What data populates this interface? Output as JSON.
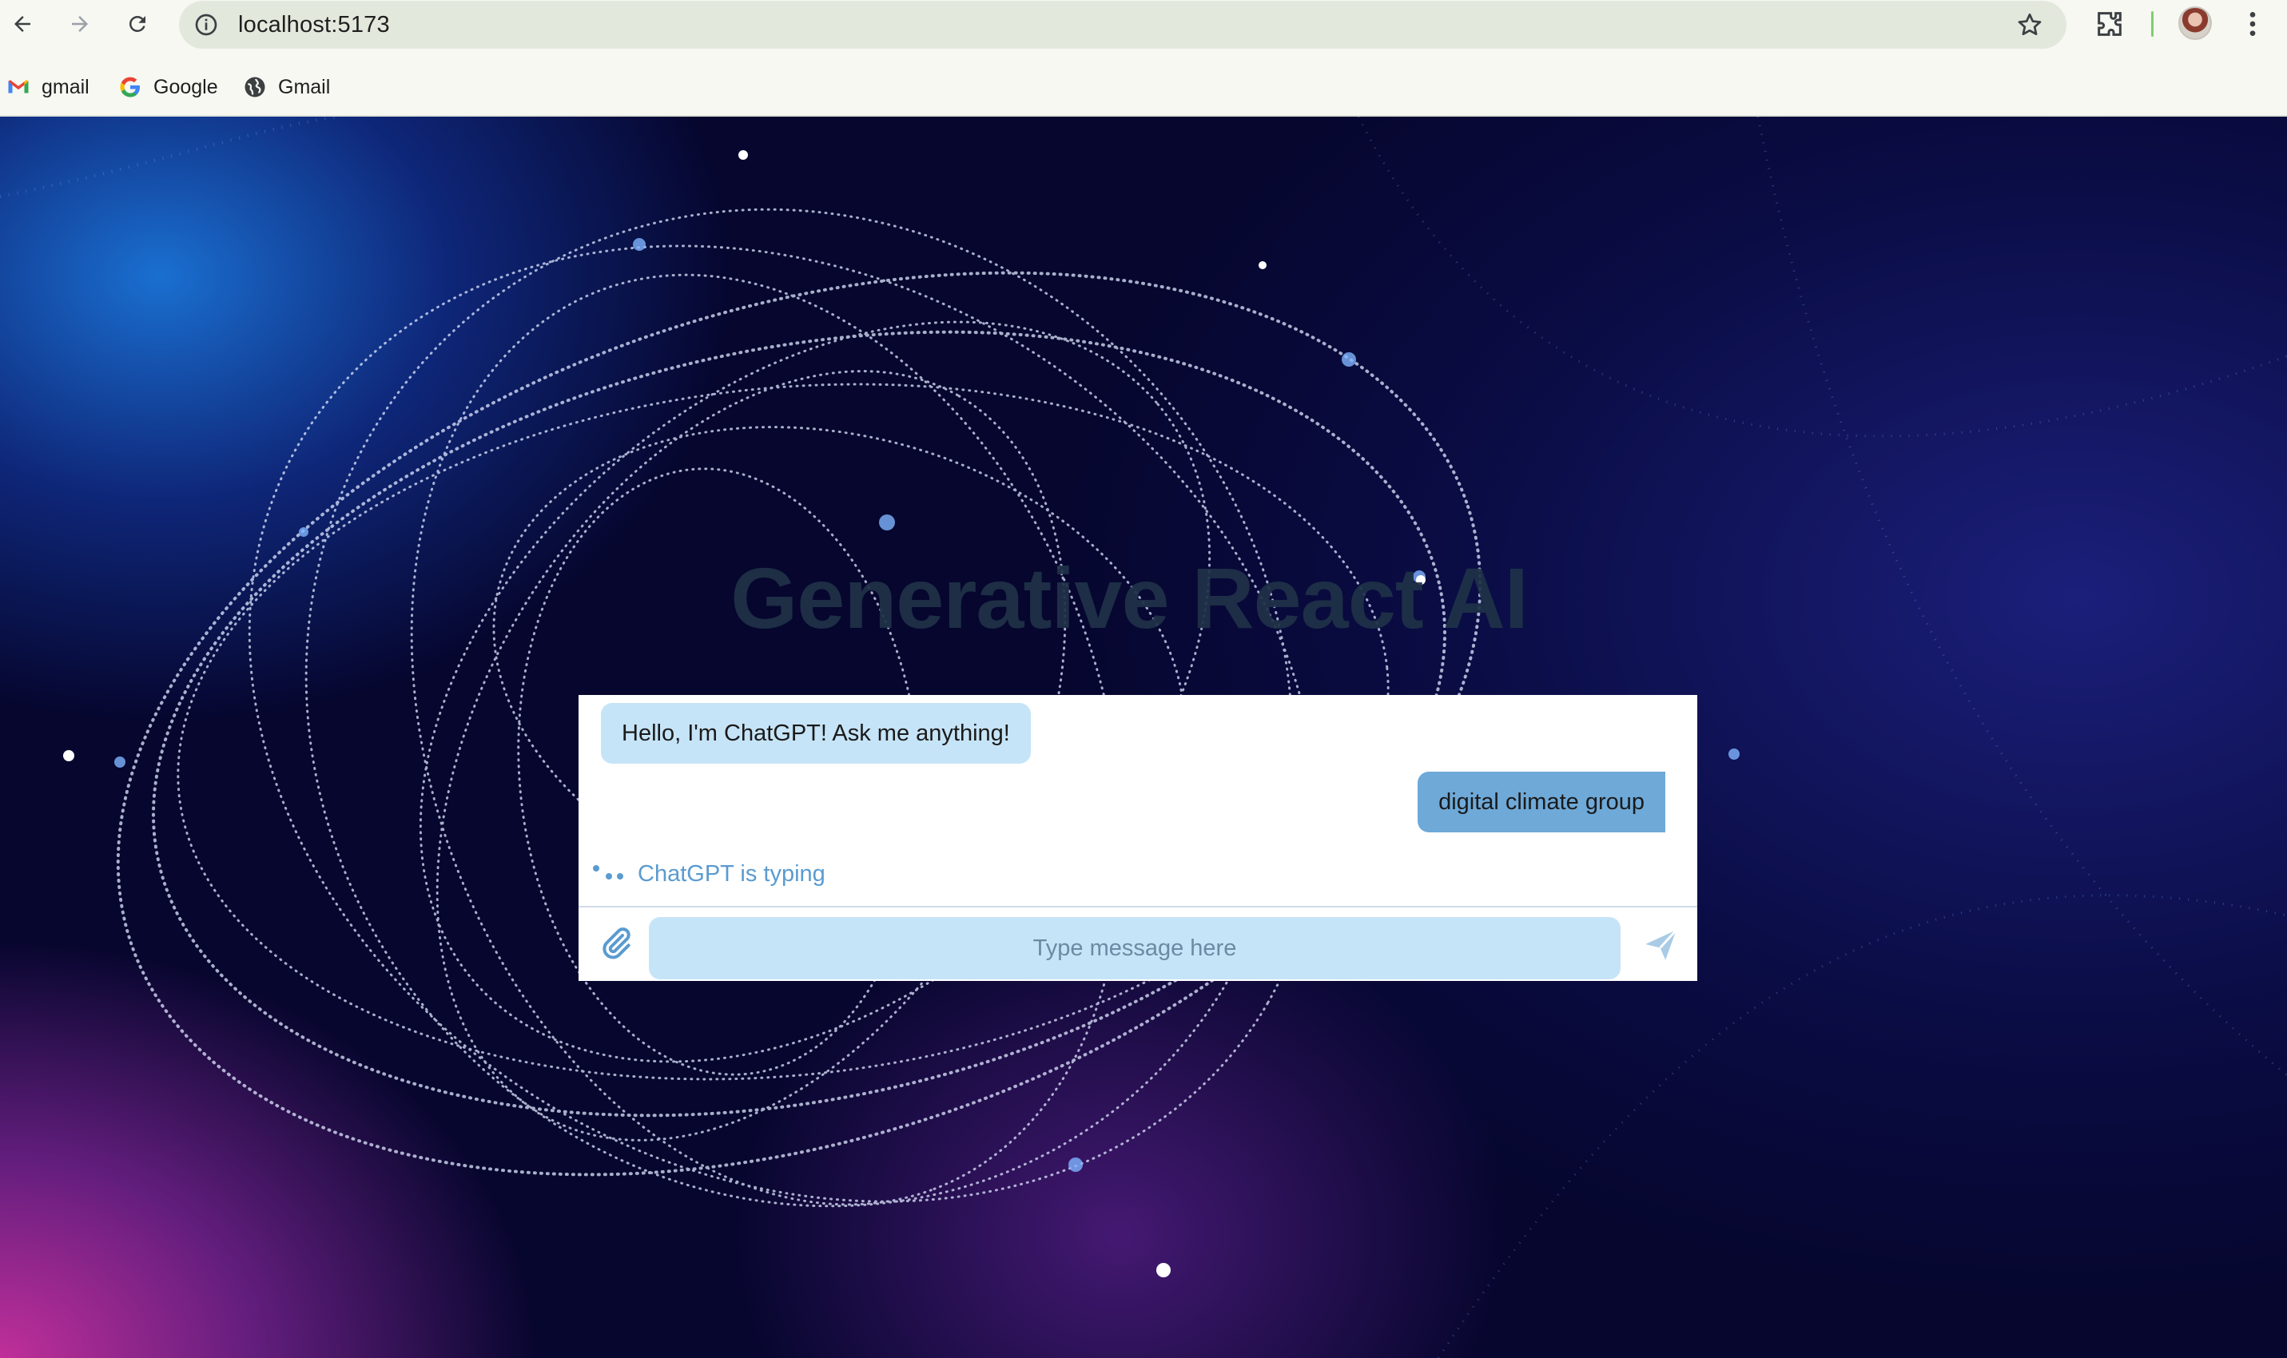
{
  "browser": {
    "url": "localhost:5173",
    "bookmarks": [
      {
        "label": "gmail",
        "icon": "gmail-icon"
      },
      {
        "label": "Google",
        "icon": "google-icon"
      },
      {
        "label": "Gmail",
        "icon": "globe-icon"
      }
    ]
  },
  "page": {
    "headline": "Generative React AI"
  },
  "chat": {
    "messages": [
      {
        "direction": "incoming",
        "text": "Hello, I'm ChatGPT! Ask me anything!"
      },
      {
        "direction": "outgoing",
        "text": "digital climate group"
      }
    ],
    "typing_indicator": "ChatGPT is typing",
    "input_placeholder": "Type message here",
    "input_value": ""
  },
  "colors": {
    "incoming_bubble": "#c6e4f7",
    "outgoing_bubble": "#6ea9d8",
    "typing_text": "#5a9bd0",
    "headline": "#1f3248"
  }
}
